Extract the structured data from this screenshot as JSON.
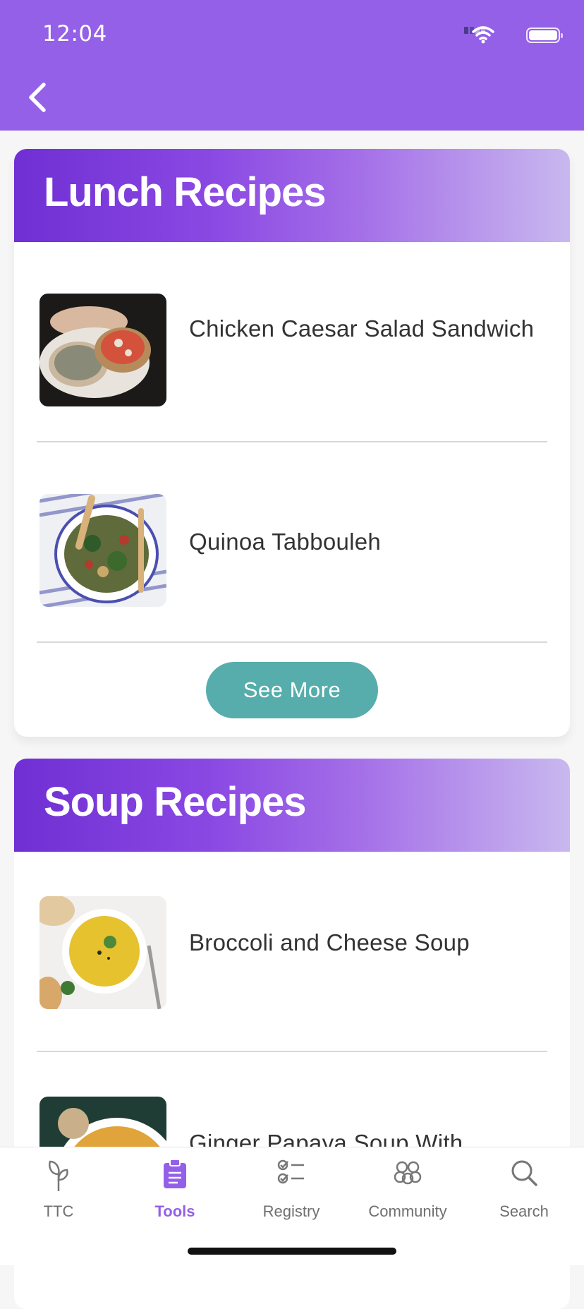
{
  "status_bar": {
    "time": "12:04"
  },
  "header": {
    "back_icon": "chevron-left-icon"
  },
  "sections": [
    {
      "title": "Lunch Recipes",
      "recipes": [
        {
          "name": "Chicken Caesar Salad Sandwich",
          "image": "open-faced sandwich photo"
        },
        {
          "name": "Quinoa Tabbouleh",
          "image": "tabbouleh bowl photo"
        }
      ],
      "see_more_label": "See More"
    },
    {
      "title": "Soup Recipes",
      "recipes": [
        {
          "name": "Broccoli and Cheese Soup",
          "image": "yellow soup bowl photo"
        },
        {
          "name": "Ginger Papaya Soup With",
          "image": "orange soup bowl photo"
        }
      ]
    }
  ],
  "tabbar": {
    "tabs": [
      {
        "label": "TTC",
        "icon": "sprout-icon"
      },
      {
        "label": "Tools",
        "icon": "clipboard-icon",
        "active": true
      },
      {
        "label": "Registry",
        "icon": "checklist-icon"
      },
      {
        "label": "Community",
        "icon": "people-icon"
      },
      {
        "label": "Search",
        "icon": "search-icon"
      }
    ]
  },
  "colors": {
    "header": "#9460e8",
    "accent": "#9460e8",
    "see_more_button": "#56adac",
    "banner_start": "#6f2fd3",
    "banner_end": "#c9b8ef"
  }
}
